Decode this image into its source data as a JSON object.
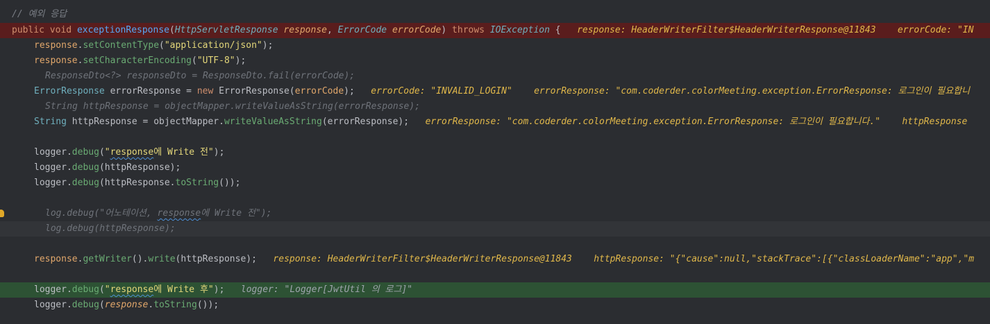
{
  "lines": {
    "l1": "// 예외 응답",
    "l2": {
      "kw1": "public",
      "kw2": "void",
      "fn": "exceptionResponse",
      "p_open": "(",
      "type1": "HttpServletResponse",
      "param1": "response",
      "comma": ", ",
      "type2": "ErrorCode",
      "param2": "errorCode",
      "p_close": ")",
      "kw3": "throws",
      "type3": "IOException",
      "brace": " {",
      "inlay": "response: HeaderWriterFilter$HeaderWriterResponse@11843    errorCode: \"IN"
    },
    "l3": {
      "obj": "response",
      "dot": ".",
      "method": "setContentType",
      "open": "(",
      "arg": "\"application/json\"",
      "close": ");"
    },
    "l4": {
      "obj": "response",
      "dot": ".",
      "method": "setCharacterEncoding",
      "open": "(",
      "arg": "\"UTF-8\"",
      "close": ");"
    },
    "l5": "ResponseDto<?> responseDto = ResponseDto.fail(errorCode);",
    "l6": {
      "type": "ErrorResponse",
      "var": " errorResponse = ",
      "kw": "new",
      "cls": " ErrorResponse",
      "open": "(",
      "arg": "errorCode",
      "close": ");",
      "inlay": "errorCode: \"INVALID_LOGIN\"    errorResponse: \"com.coderder.colorMeeting.exception.ErrorResponse: 로그인이 필요합니"
    },
    "l7": "String httpResponse = objectMapper.writeValueAsString(errorResponse);",
    "l8": {
      "type": "String",
      "var": " httpResponse = objectMapper.",
      "method": "writeValueAsString",
      "args": "(errorResponse);",
      "inlay": "errorResponse: \"com.coderder.colorMeeting.exception.ErrorResponse: 로그인이 필요합니다.\"    httpResponse"
    },
    "l9": {
      "obj": "logger.",
      "method": "debug",
      "open": "(",
      "str_q": "\"",
      "str_sq": "response",
      "str_rest": "에 Write 전\"",
      "close": ");"
    },
    "l10": {
      "obj": "logger.",
      "method": "debug",
      "args": "(httpResponse);"
    },
    "l11": {
      "obj": "logger.",
      "method": "debug",
      "args1": "(httpResponse.",
      "method2": "toString",
      "args2": "());"
    },
    "l12": {
      "pre": "log.debug(\"어노테이션, ",
      "sq": "response",
      "post": "에 Write 전\");"
    },
    "l13": "log.debug(httpResponse);",
    "l14": {
      "obj": "response",
      "dot1": ".",
      "method1": "getWriter",
      "mid": "().",
      "method2": "write",
      "args": "(httpResponse);",
      "inlay": "response: HeaderWriterFilter$HeaderWriterResponse@11843    httpResponse: \"{\"cause\":null,\"stackTrace\":[{\"classLoaderName\":\"app\",\"m"
    },
    "l15": {
      "obj": "logger.",
      "method": "debug",
      "open": "(",
      "str_q": "\"",
      "str_sq": "response",
      "str_rest": "에 Write 후\"",
      "close": ");",
      "inlay": "logger: \"Logger[JwtUtil 의 로그]\""
    },
    "l16": {
      "obj": "logger.",
      "method": "debug",
      "open": "(",
      "arg": "response",
      "dot": ".",
      "method2": "toString",
      "close": "());"
    }
  },
  "icons": {
    "intention": "lightbulb-icon"
  },
  "colors": {
    "breakpoint_line": "#5a1d1d",
    "execution_line": "#2d5234",
    "background": "#2b2d31"
  }
}
